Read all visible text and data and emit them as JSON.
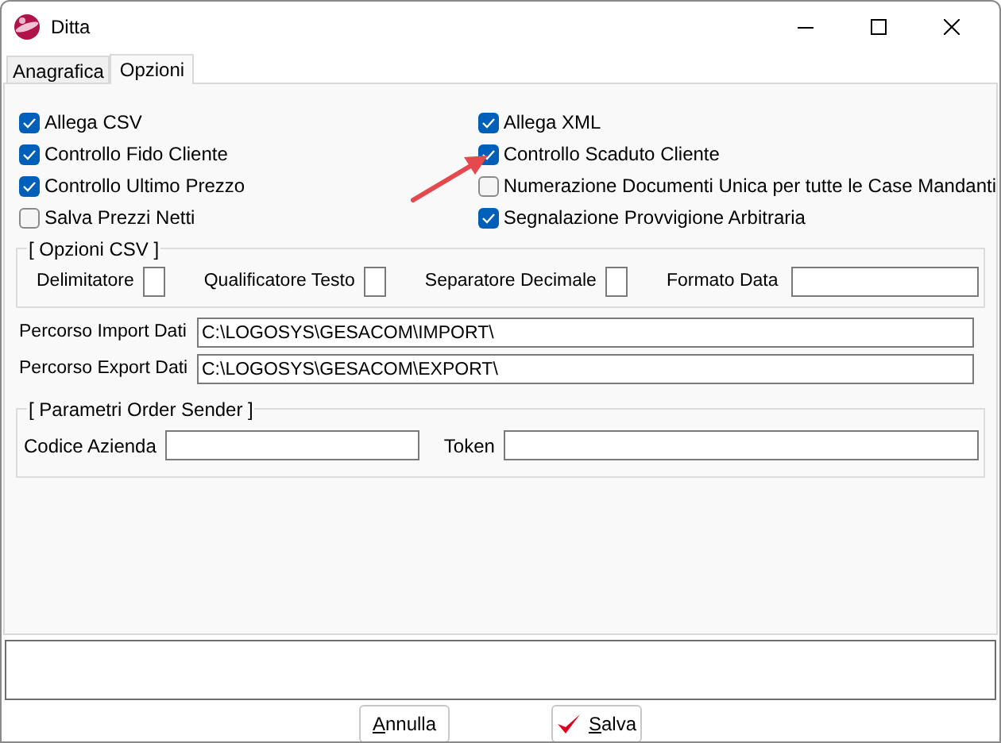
{
  "window": {
    "title": "Ditta"
  },
  "tabs": [
    {
      "label": "Anagrafica",
      "selected": false
    },
    {
      "label": "Opzioni",
      "selected": true
    }
  ],
  "options_left": [
    {
      "label": "Allega CSV",
      "checked": true
    },
    {
      "label": "Controllo Fido Cliente",
      "checked": true
    },
    {
      "label": "Controllo Ultimo Prezzo",
      "checked": true
    },
    {
      "label": "Salva Prezzi Netti",
      "checked": false
    }
  ],
  "options_right": [
    {
      "label": "Allega XML",
      "checked": true
    },
    {
      "label": "Controllo Scaduto Cliente",
      "checked": true
    },
    {
      "label": "Numerazione Documenti Unica per tutte le Case Mandanti",
      "checked": false
    },
    {
      "label": "Segnalazione Provvigione Arbitraria",
      "checked": true
    }
  ],
  "annotation_arrow": true,
  "csv_group": {
    "title": "[ Opzioni CSV ]",
    "fields": [
      {
        "label": "Delimitatore",
        "kind": "char"
      },
      {
        "label": "Qualificatore Testo",
        "kind": "char"
      },
      {
        "label": "Separatore Decimale",
        "kind": "char"
      },
      {
        "label": "Formato Data",
        "kind": "wide"
      }
    ]
  },
  "paths": [
    {
      "label": "Percorso Import Dati",
      "value": "C:\\LOGOSYS\\GESACOM\\IMPORT\\"
    },
    {
      "label": "Percorso Export Dati",
      "value": "C:\\LOGOSYS\\GESACOM\\EXPORT\\"
    }
  ],
  "order_sender": {
    "title": "[ Parametri Order Sender ]",
    "fields": [
      {
        "label": "Codice Azienda"
      },
      {
        "label": "Token"
      }
    ]
  },
  "buttons": [
    {
      "label": "Annulla",
      "kind": "plain"
    },
    {
      "label": "Salva",
      "kind": "check"
    }
  ]
}
